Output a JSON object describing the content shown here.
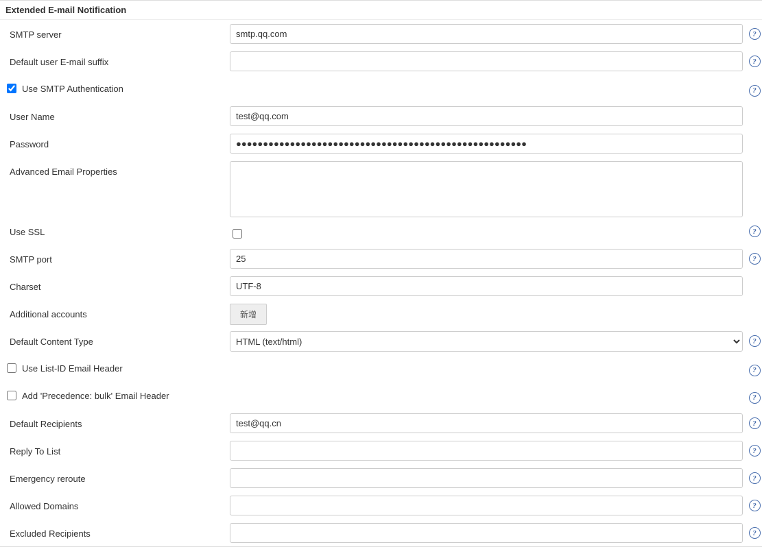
{
  "section_title": "Extended E-mail Notification",
  "labels": {
    "smtp_server": "SMTP server",
    "default_suffix": "Default user E-mail suffix",
    "use_smtp_auth": "Use SMTP Authentication",
    "user_name": "User Name",
    "password": "Password",
    "adv_props": "Advanced Email Properties",
    "use_ssl": "Use SSL",
    "smtp_port": "SMTP port",
    "charset": "Charset",
    "additional_accounts": "Additional accounts",
    "default_content_type": "Default Content Type",
    "use_list_id": "Use List-ID Email Header",
    "add_precedence": "Add 'Precedence: bulk' Email Header",
    "default_recipients": "Default Recipients",
    "reply_to_list": "Reply To List",
    "emergency_reroute": "Emergency reroute",
    "allowed_domains": "Allowed Domains",
    "excluded_recipients": "Excluded Recipients"
  },
  "values": {
    "smtp_server": "smtp.qq.com",
    "default_suffix": "",
    "user_name": "test@qq.com",
    "password": "●●●●●●●●●●●●●●●●●●●●●●●●●●●●●●●●●●●●●●●●●●●●●●●●●●●●●●",
    "adv_props": "",
    "smtp_port": "25",
    "charset": "UTF-8",
    "default_content_type": "HTML (text/html)",
    "default_recipients": "test@qq.cn",
    "reply_to_list": "",
    "emergency_reroute": "",
    "allowed_domains": "",
    "excluded_recipients": ""
  },
  "buttons": {
    "add_account": "新增"
  },
  "help_glyph": "?"
}
